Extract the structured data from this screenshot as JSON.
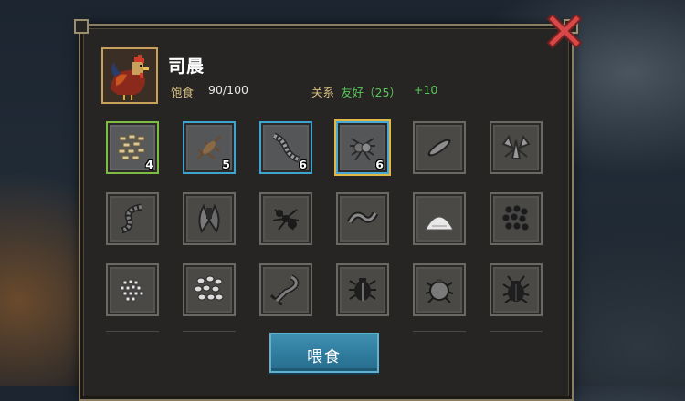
{
  "creature": {
    "name": "司晨",
    "satiety_label": "饱食",
    "satiety_value": "90/100",
    "relation_label": "关系",
    "relation_status": "友好（25）",
    "relation_delta": "+10"
  },
  "feed_button_label": "喂食",
  "colors": {
    "accent_green": "#58c75a",
    "label_gold": "#d9c184",
    "button_blue": "#2e7a9c",
    "close_red": "#c23a3a"
  },
  "food_slots": [
    {
      "icon": "grain-pile-icon",
      "count": "4",
      "state": "selected"
    },
    {
      "icon": "cricket-icon",
      "count": "5",
      "state": "available"
    },
    {
      "icon": "centipede-icon",
      "count": "6",
      "state": "available"
    },
    {
      "icon": "spider-icon",
      "count": "6",
      "state": "highlighted"
    },
    {
      "icon": "silkworm-icon",
      "count": "",
      "state": "locked"
    },
    {
      "icon": "dried-insect-icon",
      "count": "",
      "state": "locked"
    },
    {
      "icon": "larva-icon",
      "count": "",
      "state": "locked"
    },
    {
      "icon": "cicada-icon",
      "count": "",
      "state": "locked"
    },
    {
      "icon": "ant-icon",
      "count": "",
      "state": "locked"
    },
    {
      "icon": "worm-icon",
      "count": "",
      "state": "locked"
    },
    {
      "icon": "rice-pile-icon",
      "count": "",
      "state": "locked"
    },
    {
      "icon": "black-beans-icon",
      "count": "",
      "state": "locked"
    },
    {
      "icon": "millet-icon",
      "count": "",
      "state": "locked"
    },
    {
      "icon": "seeds-icon",
      "count": "",
      "state": "locked"
    },
    {
      "icon": "scorpion-icon",
      "count": "",
      "state": "locked"
    },
    {
      "icon": "beetle-icon",
      "count": "",
      "state": "locked"
    },
    {
      "icon": "tick-icon",
      "count": "",
      "state": "locked"
    },
    {
      "icon": "stag-beetle-icon",
      "count": "",
      "state": "locked"
    }
  ]
}
